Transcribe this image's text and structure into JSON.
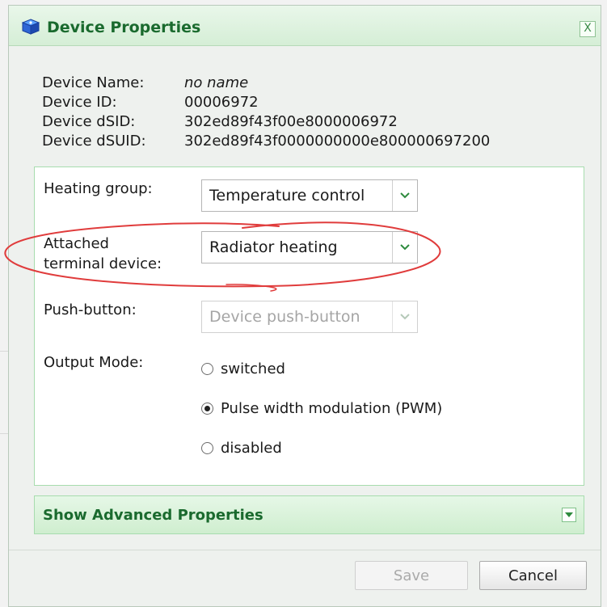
{
  "dialog": {
    "title": "Device Properties",
    "close_label": "X",
    "title_icon": "cube-icon"
  },
  "info": [
    {
      "label": "Device Name:",
      "value": "no name"
    },
    {
      "label": "Device ID:",
      "value": "00006972"
    },
    {
      "label": "Device dSID:",
      "value": "302ed89f43f00e8000006972"
    },
    {
      "label": "Device dSUID:",
      "value": "302ed89f43f0000000000e800000697200"
    }
  ],
  "properties": {
    "heating_group": {
      "label": "Heating group:",
      "value": "Temperature control"
    },
    "terminal_device": {
      "label_line1": "Attached",
      "label_line2": "terminal device:",
      "value": "Radiator heating"
    },
    "push_button": {
      "label": "Push-button:",
      "value": "Device push-button",
      "disabled": true
    },
    "output_mode": {
      "label": "Output Mode:",
      "options": [
        {
          "label": "switched",
          "checked": false
        },
        {
          "label": "Pulse width modulation (PWM)",
          "checked": true
        },
        {
          "label": "disabled",
          "checked": false
        }
      ]
    }
  },
  "advanced": {
    "label": "Show Advanced Properties"
  },
  "buttons": {
    "save": "Save",
    "cancel": "Cancel"
  },
  "colors": {
    "accent": "#1a6a2e",
    "panel_border": "#a7dcae",
    "annotation": "#e03c3c"
  }
}
